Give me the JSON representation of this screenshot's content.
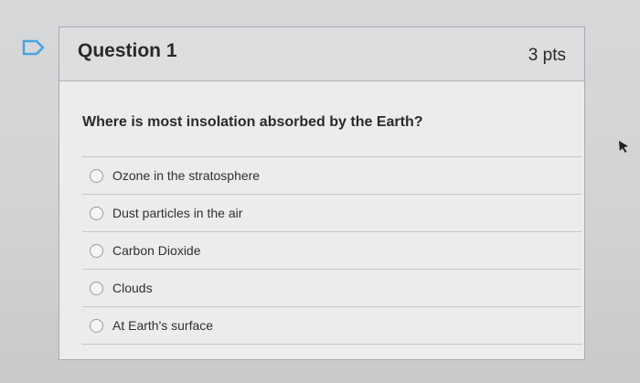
{
  "flag": {
    "icon": "flag-icon"
  },
  "question": {
    "title": "Question 1",
    "points": "3 pts",
    "text": "Where is most insolation absorbed by the Earth?",
    "answers": [
      {
        "label": "Ozone in the stratosphere",
        "selected": false
      },
      {
        "label": "Dust particles in the air",
        "selected": false
      },
      {
        "label": "Carbon Dioxide",
        "selected": false
      },
      {
        "label": "Clouds",
        "selected": false
      },
      {
        "label": "At Earth's surface",
        "selected": false
      }
    ]
  },
  "colors": {
    "background": "#d3d4d6",
    "card": "#ececed",
    "header": "#dddee0",
    "flag": "#4aa3df"
  },
  "cursor": {
    "icon": "arrow-cursor-icon"
  }
}
